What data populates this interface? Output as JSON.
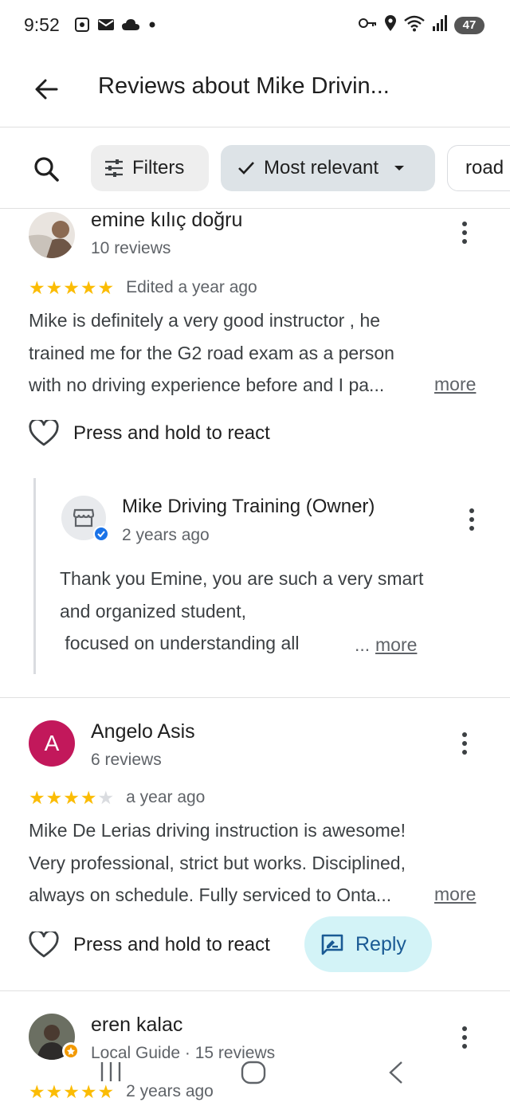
{
  "status_bar": {
    "time": "9:52",
    "battery": "47",
    "left_icons": [
      "screenshot-icon",
      "mail-icon",
      "cloud-icon",
      "dot-icon"
    ],
    "right_icons": [
      "key-icon",
      "location-icon",
      "wifi-icon",
      "signal-icon",
      "battery-icon"
    ]
  },
  "app_bar": {
    "title": "Reviews about Mike Drivin..."
  },
  "filters": {
    "filters_label": "Filters",
    "sort_label": "Most relevant",
    "topic_label": "road"
  },
  "reviews": [
    {
      "name": "emine kılıç doğru",
      "subtitle": "10 reviews",
      "rating": 5,
      "date": "Edited a year ago",
      "lines": [
        "Mike is definitely a very good instructor , he",
        "trained me for the G2 road exam as a person",
        "with no driving experience before and I pa..."
      ],
      "more": "more",
      "react_label": "Press and hold to react",
      "owner_reply": {
        "name": "Mike Driving Training (Owner)",
        "date": "2 years ago",
        "lines": [
          "Thank you Emine, you are such a very smart",
          "and organized student,",
          " focused on understanding all"
        ],
        "ellipsis": "...",
        "more": "more"
      }
    },
    {
      "name": "Angelo Asis",
      "initial": "A",
      "subtitle": "6 reviews",
      "rating": 4,
      "date": "a year ago",
      "lines": [
        "Mike De Lerias driving instruction is awesome!",
        "Very professional, strict but works. Disciplined,",
        "always on schedule. Fully serviced to Onta..."
      ],
      "more": "more",
      "react_label": "Press and hold to react",
      "reply_label": "Reply"
    },
    {
      "name": "eren kalac",
      "subtitle": "Local Guide · 15 reviews",
      "rating": 5,
      "date": "2 years ago"
    }
  ],
  "colors": {
    "star": "#fbbc04",
    "reply_bg": "#d3f3f7",
    "avatar_a": "#c2185b",
    "verified": "#1a73e8"
  }
}
